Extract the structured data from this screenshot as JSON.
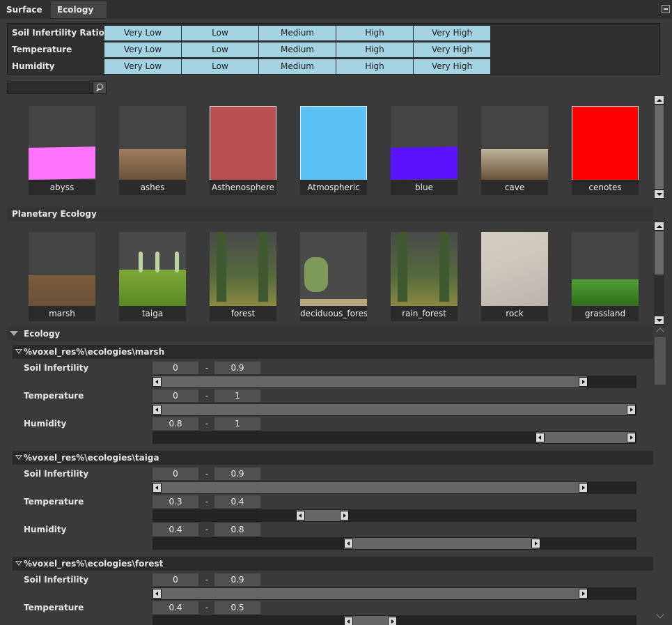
{
  "tabs": [
    {
      "label": "Surface",
      "active": true
    },
    {
      "label": "Ecology",
      "active": false
    }
  ],
  "ratios": {
    "levels": [
      "Very Low",
      "Low",
      "Medium",
      "High",
      "Very High"
    ],
    "rows": [
      {
        "label": "Soil Infertility Ratio"
      },
      {
        "label": "Temperature"
      },
      {
        "label": "Humidity"
      }
    ],
    "cell_color": "#a4d4e4"
  },
  "search": {
    "placeholder": "",
    "value": ""
  },
  "surface_materials": [
    {
      "name": "abyss",
      "color": "#ff73ff",
      "kind": "swatch-low"
    },
    {
      "name": "ashes",
      "color": "#a07e5e",
      "kind": "texture-low"
    },
    {
      "name": "Asthenosphere",
      "color": "#b94f51",
      "kind": "swatch-full"
    },
    {
      "name": "Atmospheric",
      "color": "#5ac1f4",
      "kind": "swatch-full"
    },
    {
      "name": "blue",
      "color": "#5a12ff",
      "kind": "swatch-low"
    },
    {
      "name": "cave",
      "color": "#bdb29a",
      "kind": "texture-low"
    },
    {
      "name": "cenotes",
      "color": "#ff0000",
      "kind": "swatch-full"
    }
  ],
  "planetary_label": "Planetary Ecology",
  "planetary_ecologies": [
    {
      "name": "marsh",
      "color": "#7a5c3a",
      "kind": "texture-low"
    },
    {
      "name": "taiga",
      "color": "#6c9a2c",
      "kind": "texture-mid"
    },
    {
      "name": "forest",
      "color": "#5f7040",
      "kind": "texture-forest"
    },
    {
      "name": "deciduous_forest",
      "color": "#6f8a48",
      "kind": "texture-deciduous"
    },
    {
      "name": "rain_forest",
      "color": "#5f7040",
      "kind": "texture-forest"
    },
    {
      "name": "rock",
      "color": "#d8d2c8",
      "kind": "texture-rock"
    },
    {
      "name": "grassland",
      "color": "#3f8a2a",
      "kind": "texture-grass"
    }
  ],
  "ecology_panel": {
    "title": "Ecology",
    "groups": [
      {
        "path": "%voxel_res%\\ecologies\\marsh",
        "props": [
          {
            "label": "Soil Infertility",
            "min": "0",
            "max": "0.9",
            "lo": 0,
            "hi": 0.9
          },
          {
            "label": "Temperature",
            "min": "0",
            "max": "1",
            "lo": 0,
            "hi": 1
          },
          {
            "label": "Humidity",
            "min": "0.8",
            "max": "1",
            "lo": 0.8,
            "hi": 1
          }
        ]
      },
      {
        "path": "%voxel_res%\\ecologies\\taiga",
        "props": [
          {
            "label": "Soil Infertility",
            "min": "0",
            "max": "0.9",
            "lo": 0,
            "hi": 0.9
          },
          {
            "label": "Temperature",
            "min": "0.3",
            "max": "0.4",
            "lo": 0.3,
            "hi": 0.4
          },
          {
            "label": "Humidity",
            "min": "0.4",
            "max": "0.8",
            "lo": 0.4,
            "hi": 0.8
          }
        ]
      },
      {
        "path": "%voxel_res%\\ecologies\\forest",
        "props": [
          {
            "label": "Soil Infertility",
            "min": "0",
            "max": "0.9",
            "lo": 0,
            "hi": 0.9
          },
          {
            "label": "Temperature",
            "min": "0.4",
            "max": "0.5",
            "lo": 0.4,
            "hi": 0.5
          }
        ]
      }
    ]
  }
}
